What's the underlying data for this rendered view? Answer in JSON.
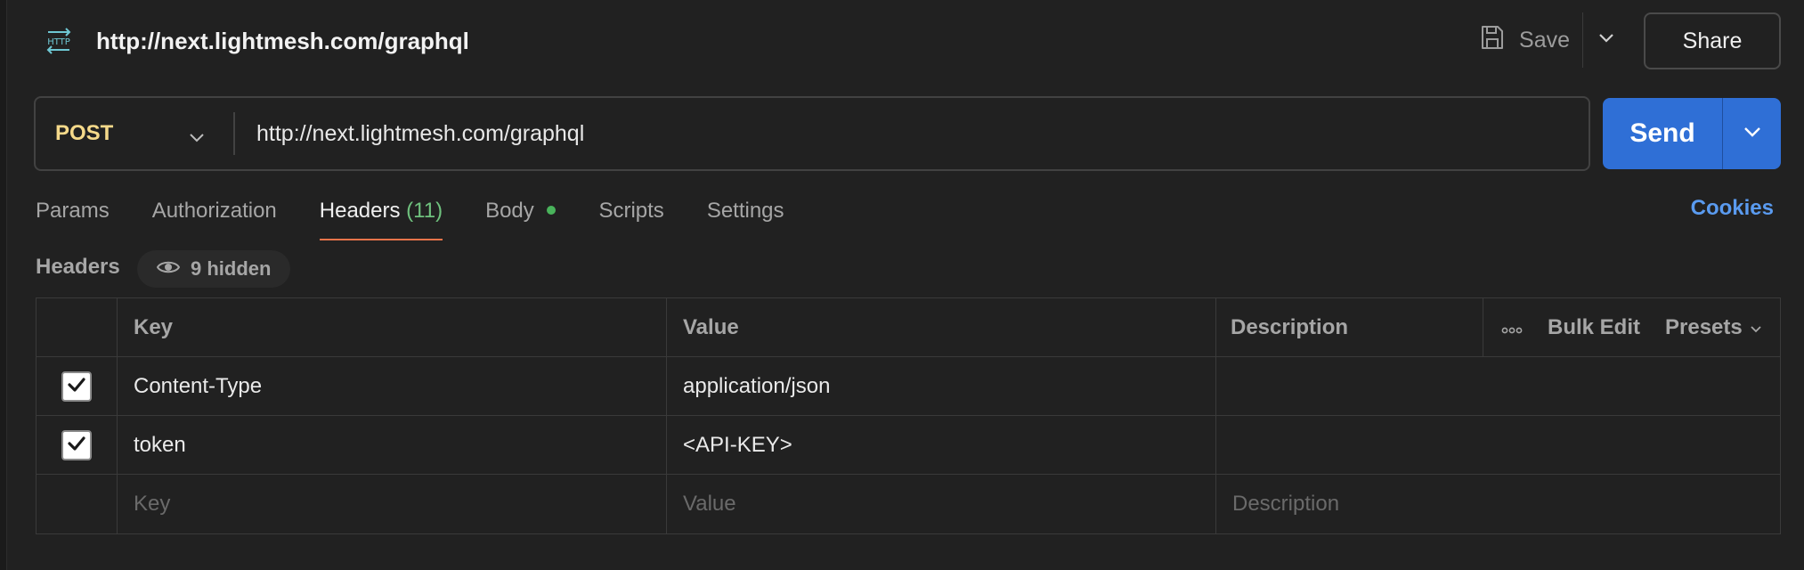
{
  "request": {
    "title": "http://next.lightmesh.com/graphql",
    "method": "POST",
    "url": "http://next.lightmesh.com/graphql"
  },
  "toolbar": {
    "save_label": "Save",
    "share_label": "Share",
    "send_label": "Send"
  },
  "tabs": [
    {
      "label": "Params"
    },
    {
      "label": "Authorization"
    },
    {
      "label": "Headers",
      "count": "(11)",
      "active": true
    },
    {
      "label": "Body",
      "has_dot": true
    },
    {
      "label": "Scripts"
    },
    {
      "label": "Settings"
    }
  ],
  "cookies_label": "Cookies",
  "headers": {
    "section_label": "Headers",
    "hidden_label": "9 hidden",
    "columns": {
      "key": "Key",
      "value": "Value",
      "description": "Description",
      "bulk_edit": "Bulk Edit",
      "presets": "Presets"
    },
    "rows": [
      {
        "checked": true,
        "key": "Content-Type",
        "value": "application/json",
        "description": ""
      },
      {
        "checked": true,
        "key": "token",
        "value": "<API-KEY>",
        "description": ""
      }
    ],
    "new_row": {
      "key_placeholder": "Key",
      "value_placeholder": "Value",
      "description_placeholder": "Description"
    }
  },
  "colors": {
    "background": "#212121",
    "method": "#f5d98a",
    "send": "#2f6fd6",
    "active_tab_underline": "#e8744a",
    "count": "#6fc27e",
    "body_dot": "#49b35b",
    "cookies": "#5a9bf0"
  },
  "icons": {
    "http": "http-icon",
    "save": "save-icon",
    "caret": "chevron-down-icon",
    "eye": "eye-icon",
    "more": "more-icon",
    "check": "check-icon"
  }
}
